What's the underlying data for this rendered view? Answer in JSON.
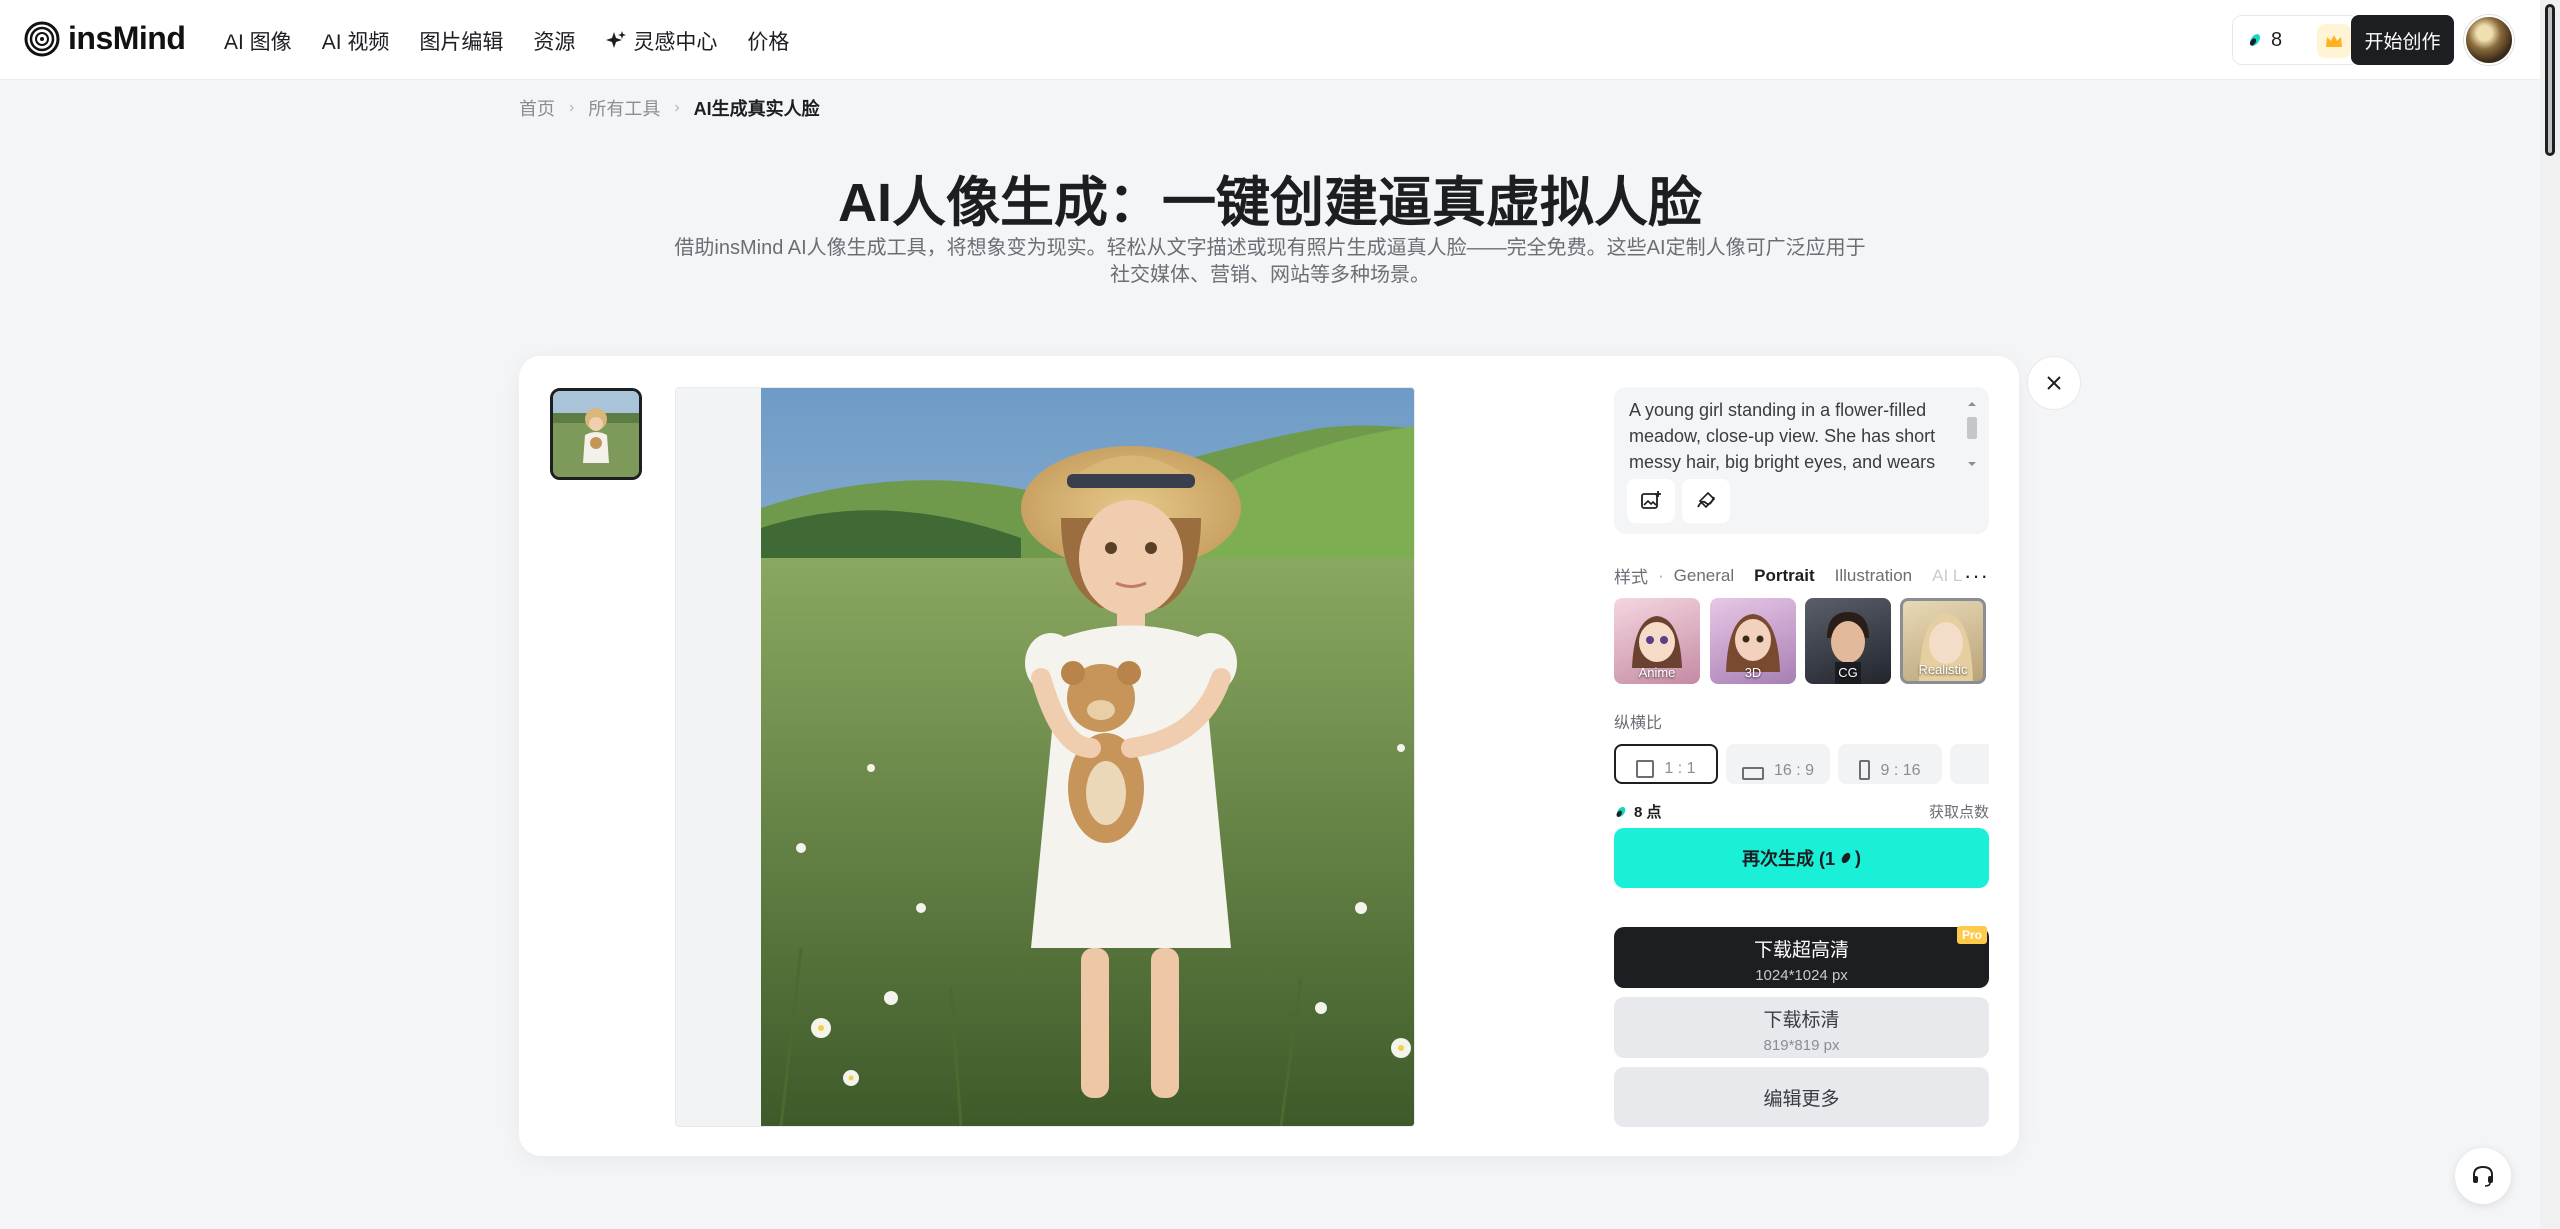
{
  "brand": {
    "name": "insMind"
  },
  "nav": {
    "items": [
      {
        "label": "AI 图像"
      },
      {
        "label": "AI 视频"
      },
      {
        "label": "图片编辑"
      },
      {
        "label": "资源"
      },
      {
        "label": "灵感中心"
      },
      {
        "label": "价格"
      }
    ],
    "credits": "8",
    "start_label": "开始创作"
  },
  "breadcrumb": {
    "home": "首页",
    "tools": "所有工具",
    "current": "AI生成真实人脸"
  },
  "hero": {
    "title": "AI人像生成：一键创建逼真虚拟人脸",
    "description": "借助insMind AI人像生成工具，将想象变为现实。轻松从文字描述或现有照片生成逼真人脸——完全免费。这些AI定制人像可广泛应用于社交媒体、营销、网站等多种场景。"
  },
  "panel": {
    "prompt": "A young girl standing in a flower-filled meadow, close-up view. She has short messy hair, big bright eyes, and wears",
    "style_label": "样式",
    "style_tabs": [
      {
        "label": "General"
      },
      {
        "label": "Portrait"
      },
      {
        "label": "Illustration"
      },
      {
        "label": "AI L"
      }
    ],
    "style_cards": [
      {
        "label": "Anime"
      },
      {
        "label": "3D"
      },
      {
        "label": "CG"
      },
      {
        "label": "Realistic"
      }
    ],
    "ratio_label": "纵横比",
    "ratios": [
      {
        "label": "1 : 1"
      },
      {
        "label": "16 : 9"
      },
      {
        "label": "9 : 16"
      }
    ],
    "points": "8 点",
    "get_points": "获取点数",
    "regenerate": "再次生成 (1",
    "download_hd": {
      "label": "下载超高清",
      "size": "1024*1024 px",
      "tag": "Pro"
    },
    "download_sd": {
      "label": "下载标清",
      "size": "819*819 px"
    },
    "edit_more": "编辑更多"
  },
  "colors": {
    "accent": "#1af0d8",
    "dark": "#1d1e22",
    "pro": "#ffc94a"
  }
}
